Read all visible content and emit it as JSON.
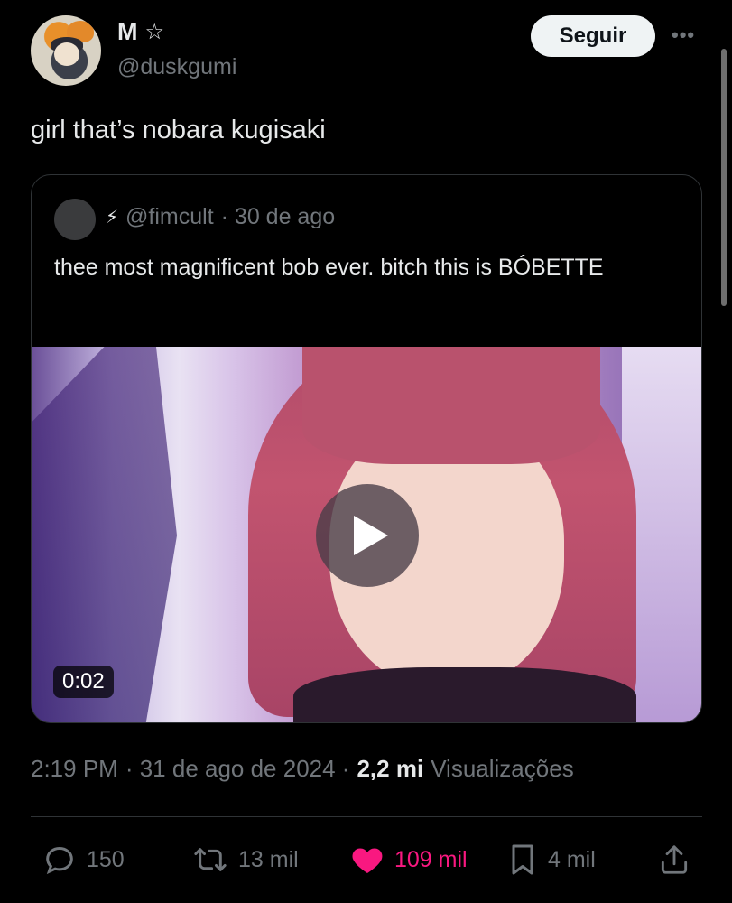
{
  "author": {
    "name": "M",
    "badge_icon": "star-outline-icon",
    "handle": "@duskgumi"
  },
  "follow_label": "Seguir",
  "more_icon": "more-horizontal-icon",
  "tweet_text": "girl that’s nobara kugisaki",
  "quoted": {
    "bolt_icon": "lightning-icon",
    "handle": "@fimcult",
    "time": "· 30 de ago",
    "text": "thee most magnificent bob ever. bitch this is BÓBETTE",
    "video": {
      "duration": "0:02"
    }
  },
  "meta": {
    "time": "2:19 PM",
    "date": "· 31 de ago de 2024 ·",
    "views": "2,2 mi",
    "views_label": "Visualizações"
  },
  "actions": {
    "replies": "150",
    "reposts": "13 mil",
    "likes": "109 mil",
    "bookmarks": "4 mil"
  },
  "colors": {
    "background": "#000000",
    "like": "#f91880",
    "muted": "#71767b",
    "text": "#e7e9ea"
  }
}
